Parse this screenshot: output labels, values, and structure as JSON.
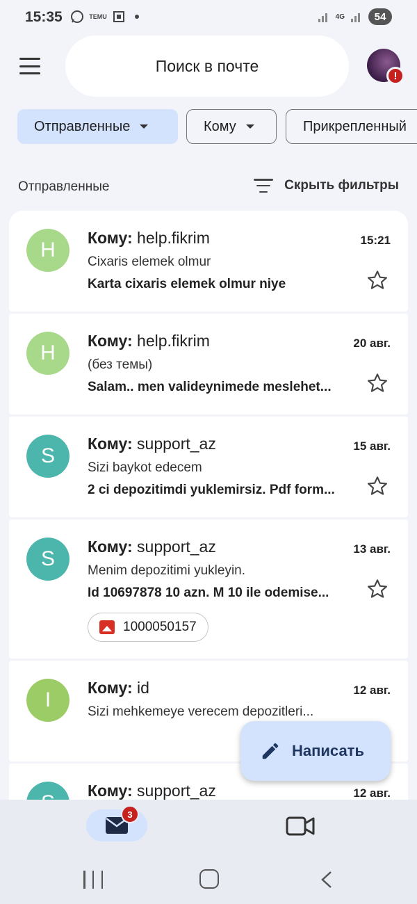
{
  "status_bar": {
    "time": "15:35",
    "temu_label": "TEMU",
    "network": "4G",
    "battery": "54"
  },
  "header": {
    "search_placeholder": "Поиск в почте",
    "alert_mark": "!"
  },
  "chips": [
    {
      "label": "Отправленные",
      "active": true
    },
    {
      "label": "Кому",
      "active": false
    },
    {
      "label": "Прикрепленный",
      "active": false
    }
  ],
  "section": {
    "title": "Отправленные",
    "hide_filters": "Скрыть фильтры"
  },
  "emails": [
    {
      "avatar": "H",
      "avatar_color": "#a8d98a",
      "to_prefix": "Кому:",
      "to": "help.fikrim",
      "date": "15:21",
      "subject": "Cixaris elemek olmur",
      "snippet": "Karta cixaris elemek olmur niye"
    },
    {
      "avatar": "H",
      "avatar_color": "#a8d98a",
      "to_prefix": "Кому:",
      "to": "help.fikrim",
      "date": "20 авг.",
      "subject": "(без темы)",
      "snippet": "Salam.. men valideynimede meslehet..."
    },
    {
      "avatar": "S",
      "avatar_color": "#4db6ac",
      "to_prefix": "Кому:",
      "to": "support_az",
      "date": "15 авг.",
      "subject": "Sizi baykot edecem",
      "snippet": "2 ci depozitimdi yuklemirsiz. Pdf form..."
    },
    {
      "avatar": "S",
      "avatar_color": "#4db6ac",
      "to_prefix": "Кому:",
      "to": "support_az",
      "date": "13 авг.",
      "subject": "Menim depozitimi yukleyin.",
      "snippet": "Id 10697878 10 azn. M 10 ile odemise...",
      "attachment": "1000050157"
    },
    {
      "avatar": "I",
      "avatar_color": "#9ccc65",
      "to_prefix": "Кому:",
      "to": "id",
      "date": "12 авг.",
      "subject": "Sizi mehkemeye verecem depozitleri...",
      "snippet": ""
    },
    {
      "avatar": "S",
      "avatar_color": "#4db6ac",
      "to_prefix": "Кому:",
      "to": "support_az",
      "date": "12 авг.",
      "subject": "",
      "snippet": ""
    }
  ],
  "fab": {
    "label": "Написать"
  },
  "bottom_nav": {
    "mail_badge": "3"
  },
  "colors": {
    "accent": "#d3e3fd",
    "badge": "#c5221f",
    "background": "#f3f4fa"
  }
}
